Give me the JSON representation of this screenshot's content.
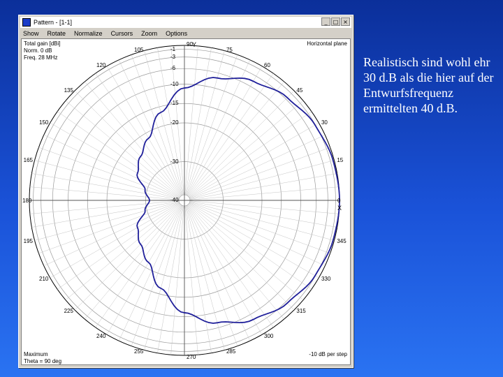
{
  "window": {
    "title": "Pattern - [1-1]",
    "buttons": [
      "_",
      "□",
      "×"
    ],
    "menu": [
      "Show",
      "Rotate",
      "Normalize",
      "Cursors",
      "Zoom",
      "Options"
    ]
  },
  "plot": {
    "info_lines": [
      "Total gain [dBi]",
      "Norm. 0 dB",
      "Freq. 28 MHz"
    ],
    "plane_label": "Horizontal plane",
    "y_axis_label": "Y",
    "x_axis_label": "X",
    "footer_left": [
      "Maximum",
      "Theta = 90 deg"
    ],
    "footer_right": "-10 dB per step",
    "angle_labels": [
      {
        "angle": 90,
        "text": "90"
      },
      {
        "angle": 75,
        "text": "75"
      },
      {
        "angle": 60,
        "text": "60"
      },
      {
        "angle": 45,
        "text": "45"
      },
      {
        "angle": 30,
        "text": "30"
      },
      {
        "angle": 15,
        "text": "15"
      },
      {
        "angle": 0,
        "text": "0"
      },
      {
        "angle": 345,
        "text": "345"
      },
      {
        "angle": 330,
        "text": "330"
      },
      {
        "angle": 315,
        "text": "315"
      },
      {
        "angle": 300,
        "text": "300"
      },
      {
        "angle": 285,
        "text": "285"
      },
      {
        "angle": 270,
        "text": "270"
      },
      {
        "angle": 255,
        "text": "255"
      },
      {
        "angle": 240,
        "text": "240"
      },
      {
        "angle": 225,
        "text": "225"
      },
      {
        "angle": 210,
        "text": "210"
      },
      {
        "angle": 195,
        "text": "195"
      },
      {
        "angle": 180,
        "text": "180"
      },
      {
        "angle": 165,
        "text": "165"
      },
      {
        "angle": 150,
        "text": "150"
      },
      {
        "angle": 135,
        "text": "135"
      },
      {
        "angle": 120,
        "text": "120"
      },
      {
        "angle": 105,
        "text": "105"
      }
    ],
    "db_labels": [
      "-1",
      "-3",
      "-6",
      "-10",
      "-15",
      "-20",
      "-30",
      "-40"
    ],
    "trace_color": "#1f1f9a"
  },
  "chart_data": {
    "type": "polar",
    "title": "Horizontal plane",
    "unit": "dBi",
    "series": [
      {
        "points": [
          {
            "angle": 0,
            "dB": 0
          },
          {
            "angle": 15,
            "dB": -0.3
          },
          {
            "angle": 30,
            "dB": -1.1
          },
          {
            "angle": 45,
            "dB": -2.5
          },
          {
            "angle": 60,
            "dB": -4.5
          },
          {
            "angle": 75,
            "dB": -7.3
          },
          {
            "angle": 90,
            "dB": -11
          },
          {
            "angle": 105,
            "dB": -16.5
          },
          {
            "angle": 120,
            "dB": -21.5
          },
          {
            "angle": 135,
            "dB": -24
          },
          {
            "angle": 150,
            "dB": -26
          },
          {
            "angle": 165,
            "dB": -29.5
          },
          {
            "angle": 180,
            "dB": -31
          },
          {
            "angle": 195,
            "dB": -29.5
          },
          {
            "angle": 210,
            "dB": -26
          },
          {
            "angle": 225,
            "dB": -24
          },
          {
            "angle": 240,
            "dB": -21.5
          },
          {
            "angle": 255,
            "dB": -16.5
          },
          {
            "angle": 270,
            "dB": -11
          },
          {
            "angle": 285,
            "dB": -7.3
          },
          {
            "angle": 300,
            "dB": -4.5
          },
          {
            "angle": 315,
            "dB": -2.5
          },
          {
            "angle": 330,
            "dB": -1.1
          },
          {
            "angle": 345,
            "dB": -0.3
          }
        ]
      }
    ]
  },
  "slide": {
    "text": "Realistisch sind wohl ehr 30 d.B als die hier auf der Entwurfsfrequenz ermittelten 40 d.B."
  }
}
